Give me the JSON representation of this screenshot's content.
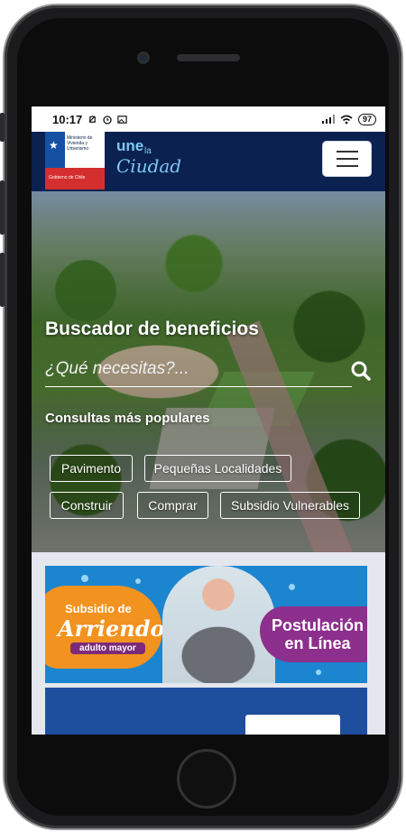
{
  "status_bar": {
    "time": "10:17",
    "battery": "97"
  },
  "header": {
    "gov_logo_text": "Ministerio de Vivienda y Urbanismo",
    "gov_logo_sub": "Gobierno de Chile",
    "une": "une",
    "la": "la",
    "ciudad": "Ciudad"
  },
  "hero": {
    "title": "Buscador de beneficios",
    "search_placeholder": "¿Qué necesitas?...",
    "popular_title": "Consultas más populares",
    "chips": [
      "Pavimento",
      "Pequeñas Localidades",
      "Construir",
      "Comprar",
      "Subsidio Vulnerables"
    ]
  },
  "banner": {
    "subsidio_de": "Subsidio de",
    "arriendo": "Arriendo",
    "adulto_mayor": "adulto mayor",
    "postulacion": "Postulación en Línea"
  },
  "colors": {
    "header_bg": "#0b2150",
    "accent_light_blue": "#7dc9f1",
    "banner_blue": "#1b85cf",
    "banner_orange": "#f2921f",
    "banner_purple": "#8d2f8c"
  }
}
